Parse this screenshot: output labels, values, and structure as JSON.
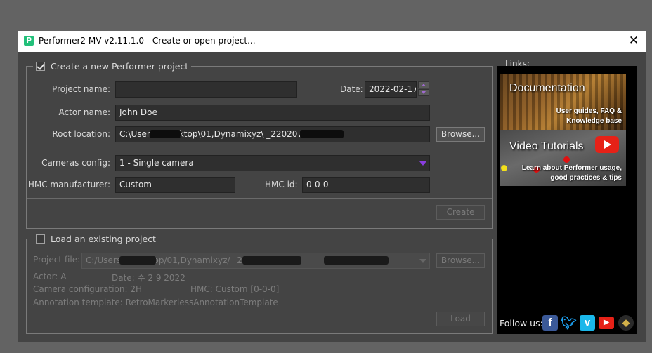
{
  "window": {
    "title": "Performer2 MV v2.11.1.0 - Create or open project...",
    "app_icon_letter": "P",
    "close_glyph": "✕"
  },
  "create": {
    "header": "Create a new Performer project",
    "checked": true,
    "project_name_label": "Project name:",
    "project_name_value": "",
    "date_label": "Date:",
    "date_value": "2022-02-17",
    "actor_name_label": "Actor name:",
    "actor_name_value": "John Doe",
    "root_location_label": "Root location:",
    "root_location_value": "C:\\Users\\      \\Desktop\\01,Dynamixyz\\                _220207",
    "browse_label": "Browse...",
    "cameras_config_label": "Cameras config:",
    "cameras_config_value": "1 - Single camera",
    "hmc_manufacturer_label": "HMC manufacturer:",
    "hmc_manufacturer_value": "Custom",
    "hmc_id_label": "HMC id:",
    "hmc_id_value": "0-0-0",
    "create_label": "Create"
  },
  "load": {
    "header": "Load an existing project",
    "checked": false,
    "project_file_label": "Project file:",
    "project_file_value": "C:/Users/       /Desktop/01,Dynamixyz/               _220207/                  .pproj",
    "browse_label": "Browse...",
    "actor": "Actor: A",
    "date": "Date: 수 2 9 2022",
    "camera_configuration": "Camera configuration: 2H",
    "hmc": "HMC: Custom [0-0-0]",
    "annotation_template": "Annotation template: RetroMarkerlessAnnotationTemplate",
    "load_label": "Load"
  },
  "links": {
    "header": "Links:",
    "documentation": {
      "title": "Documentation",
      "subtitle_line1": "User guides, FAQ &",
      "subtitle_line2": "Knowledge base"
    },
    "video_tutorials": {
      "title": "Video Tutorials",
      "subtitle_line1": "Learn about Performer usage,",
      "subtitle_line2": "good practices & tips"
    },
    "follow_us": "Follow us:",
    "social_icons": [
      "facebook-icon",
      "twitter-icon",
      "vimeo-icon",
      "youtube-icon",
      "dynamixyz-icon"
    ],
    "social_colors": {
      "facebook": "#3b5998",
      "twitter": "#1da1f2",
      "vimeo": "#1ab7ea",
      "youtube": "#e62117"
    }
  }
}
